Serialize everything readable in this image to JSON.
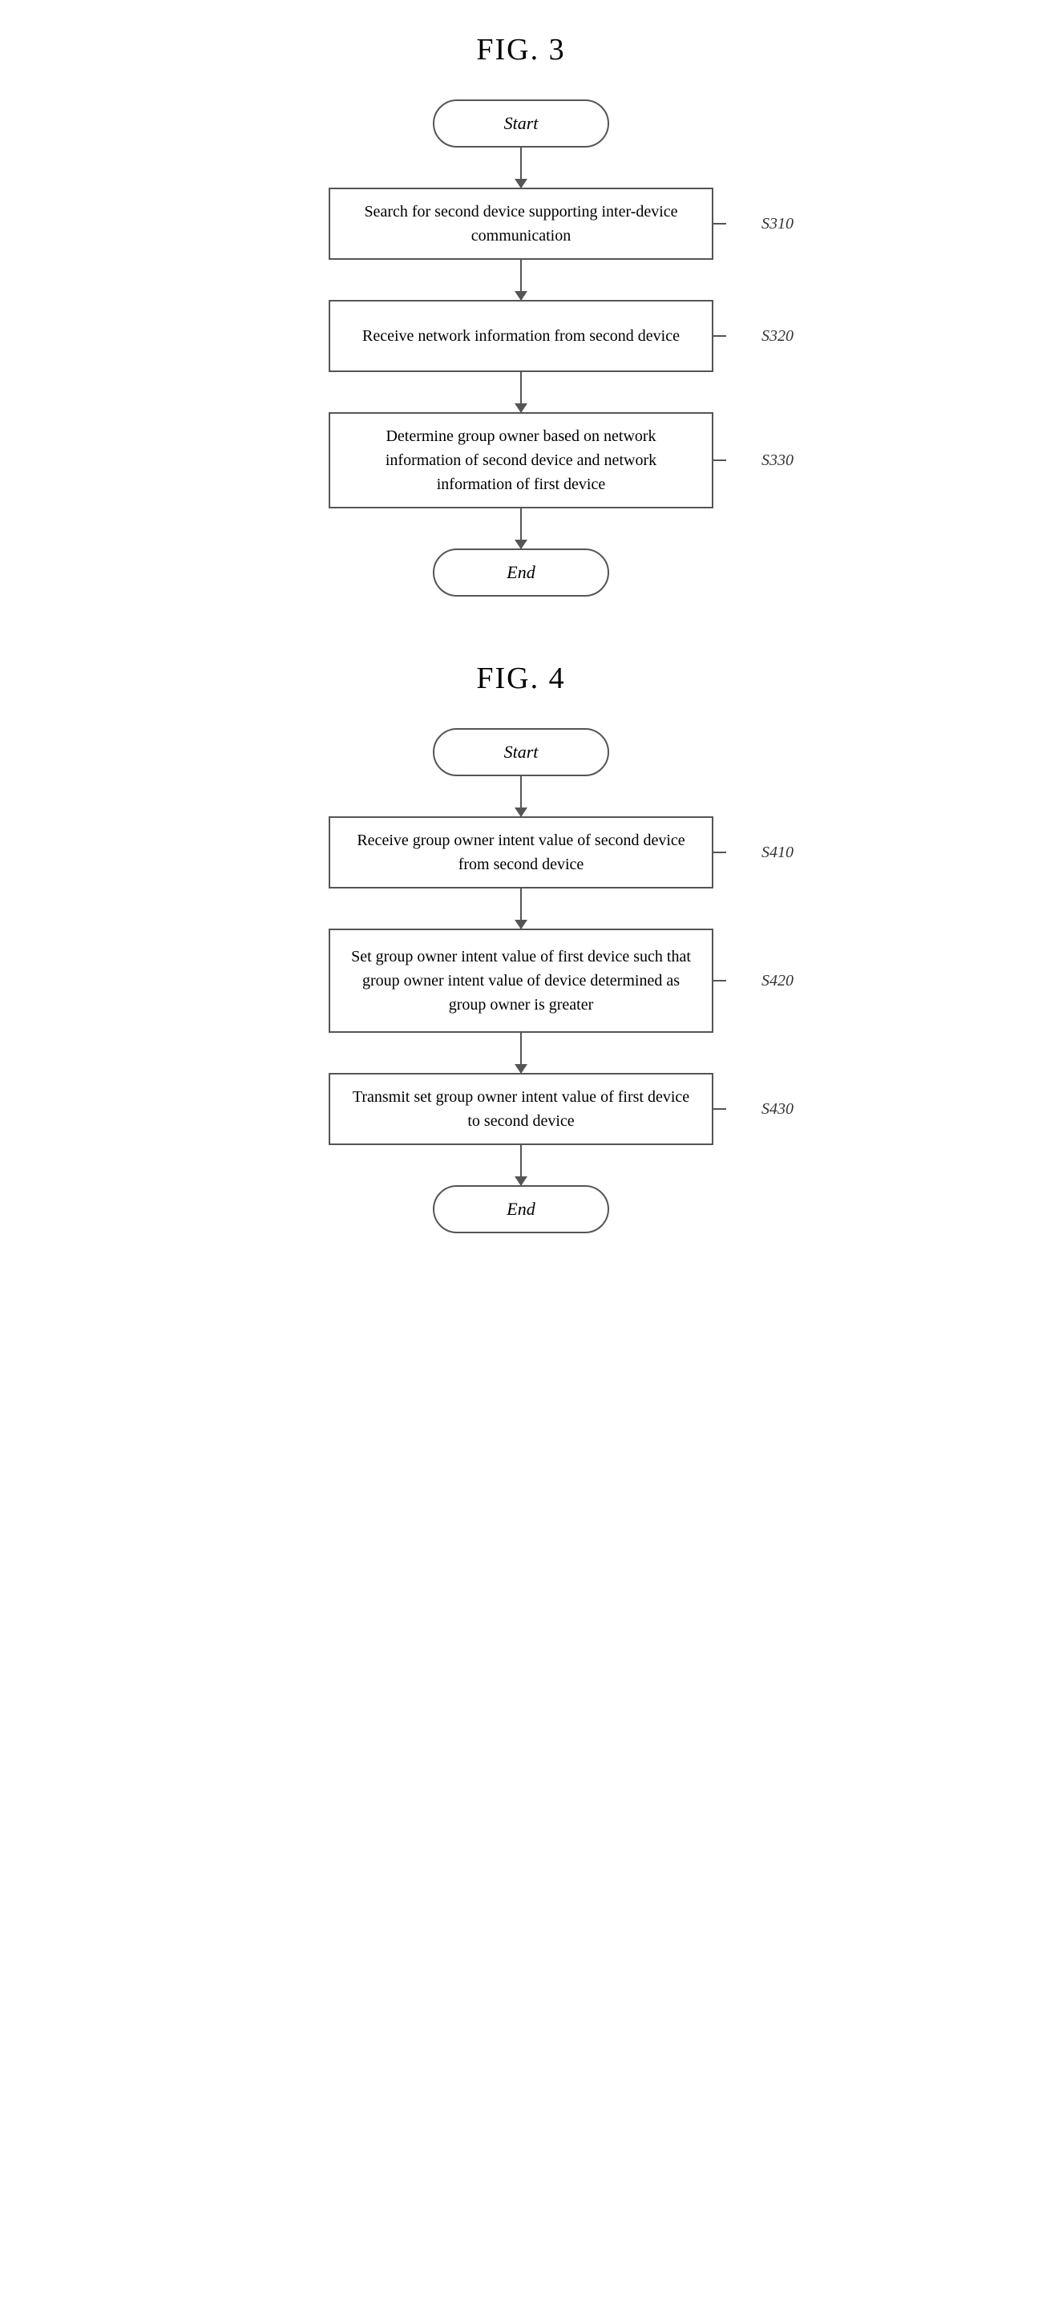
{
  "fig3": {
    "title": "FIG. 3",
    "start_label": "Start",
    "end_label": "End",
    "steps": [
      {
        "id": "S310",
        "text": "Search for second device supporting inter-device communication"
      },
      {
        "id": "S320",
        "text": "Receive network information from second device"
      },
      {
        "id": "S330",
        "text": "Determine group owner based on network information of second device and network information of first device"
      }
    ]
  },
  "fig4": {
    "title": "FIG. 4",
    "start_label": "Start",
    "end_label": "End",
    "steps": [
      {
        "id": "S410",
        "text": "Receive group owner intent value of second device from second device"
      },
      {
        "id": "S420",
        "text": "Set group owner intent value of first device such that group owner intent value of device determined as group owner is greater"
      },
      {
        "id": "S430",
        "text": "Transmit set group owner intent value of first device to second device"
      }
    ]
  }
}
